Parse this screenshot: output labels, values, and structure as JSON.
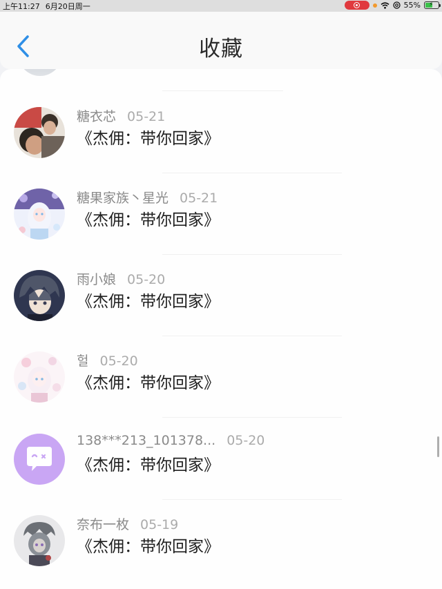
{
  "status_bar": {
    "time": "上午11:27",
    "date": "6月20日周一",
    "battery": "55%",
    "battery_level": 0.55,
    "icons": [
      "record-icon",
      "orange-dot-icon",
      "wifi-icon",
      "at-icon",
      "battery-icon"
    ]
  },
  "header": {
    "title": "收藏",
    "back_icon": "chevron-left-icon",
    "accent_color": "#2f8fe6"
  },
  "items": [
    {
      "user": "糖衣芯",
      "date": "05-21",
      "title": "《杰佣：带你回家》"
    },
    {
      "user": "糖果家族丶星光",
      "date": "05-21",
      "title": "《杰佣：带你回家》"
    },
    {
      "user": "雨小娘",
      "date": "05-20",
      "title": "《杰佣：带你回家》"
    },
    {
      "user": "헐",
      "date": "05-20",
      "title": "《杰佣：带你回家》"
    },
    {
      "user": "138***213_101378...",
      "date": "05-20",
      "title": "《杰佣：带你回家》"
    },
    {
      "user": "奈布一枚",
      "date": "05-19",
      "title": "《杰佣：带你回家》"
    }
  ]
}
